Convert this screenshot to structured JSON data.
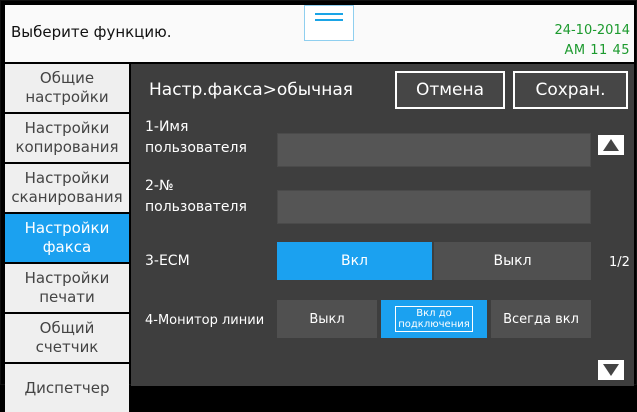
{
  "header": {
    "prompt": "Выберите функцию.",
    "date": "24-10-2014",
    "time": "AM 11  45"
  },
  "sidebar": {
    "items": [
      {
        "label": "Общие\nнастройки",
        "active": false
      },
      {
        "label": "Настройки\nкопирования",
        "active": false
      },
      {
        "label": "Настройки\nсканирования",
        "active": false
      },
      {
        "label": "Настройки\nфакса",
        "active": true
      },
      {
        "label": "Настройки\nпечати",
        "active": false
      },
      {
        "label": "Общий\nсчетчик",
        "active": false
      },
      {
        "label": "Диспетчер",
        "active": false
      }
    ]
  },
  "main": {
    "title": "Настр.факса>обычная",
    "cancel_label": "Отмена",
    "save_label": "Сохран.",
    "user_name_label": "1-Имя\nпользователя",
    "user_name_value": "",
    "user_number_label": "2-№\nпользователя",
    "user_number_value": "",
    "ecm_label": "3-ECM",
    "ecm_on": "Вкл",
    "ecm_off": "Выкл",
    "monitor_label": "4-Монитор линии",
    "monitor_off": "Выкл",
    "monitor_until_line1": "Вкл до",
    "monitor_until_line2": "подключения",
    "monitor_always": "Всегда вкл",
    "page_indicator": "1/2",
    "selected_ecm": "Вкл",
    "selected_monitor": "Вкл до подключения"
  },
  "colors": {
    "accent": "#1ba1f0",
    "panel": "#3e3e3e",
    "clock": "#1c9a2e"
  },
  "icons": {
    "up": "triangle-up-icon",
    "down": "triangle-down-icon",
    "handle": "drag-handle-icon"
  }
}
